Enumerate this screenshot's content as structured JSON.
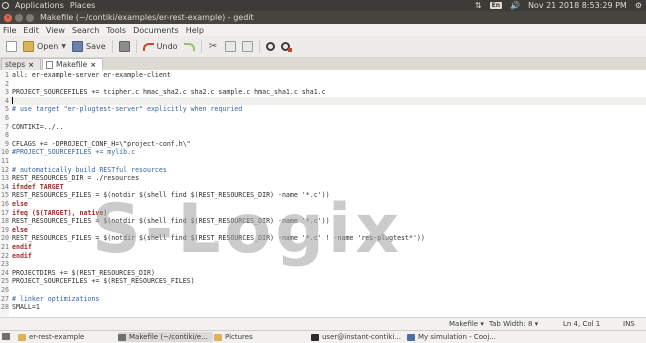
{
  "topbar": {
    "applications": "Applications",
    "places": "Places",
    "keyboard": "En",
    "datetime": "Nov 21 2018  8:53:29 PM"
  },
  "window": {
    "title": "Makefile (~/contiki/examples/er-rest-example) - gedit"
  },
  "menu": [
    "File",
    "Edit",
    "View",
    "Search",
    "Tools",
    "Documents",
    "Help"
  ],
  "toolbar": {
    "open": "Open",
    "save": "Save",
    "undo": "Undo"
  },
  "tabs": [
    {
      "label": "steps"
    },
    {
      "label": "Makefile"
    }
  ],
  "editor": {
    "lines": [
      "all: er-example-server er-example-client",
      "",
      "PROJECT_SOURCEFILES += tcipher.c hmac_sha2.c sha2.c sample.c hmac_sha1.c sha1.c",
      "",
      "# use target \"er-plugtest-server\" explicitly when requried",
      "",
      "CONTIKI=../..",
      "",
      "CFLAGS += -DPROJECT_CONF_H=\\\"project-conf.h\\\"",
      "#PROJECT_SOURCEFILES += mylib.c",
      "",
      "# automatically build RESTful resources",
      "REST_RESOURCES_DIR = ./resources",
      "ifndef TARGET",
      "REST_RESOURCES_FILES = $(notdir $(shell find $(REST_RESOURCES_DIR) -name '*.c'))",
      "else",
      "ifeq ($(TARGET), native)",
      "REST_RESOURCES_FILES = $(notdir $(shell find $(REST_RESOURCES_DIR) -name '*.c'))",
      "else",
      "REST_RESOURCES_FILES = $(notdir $(shell find $(REST_RESOURCES_DIR) -name '*.c' ! -name 'res-plugtest*'))",
      "endif",
      "endif",
      "",
      "PROJECTDIRS += $(REST_RESOURCES_DIR)",
      "PROJECT_SOURCEFILES += $(REST_RESOURCES_FILES)",
      "",
      "# linker optimizations",
      "SMALL=1"
    ]
  },
  "watermark": "S-Logix",
  "statusbar": {
    "language": "Makefile",
    "tab_width": "Tab Width: 8",
    "position": "Ln 4, Col 1",
    "mode": "INS"
  },
  "taskbar": [
    {
      "label": "er-rest-example"
    },
    {
      "label": "Makefile (~/contiki/e..."
    },
    {
      "label": "Pictures"
    },
    {
      "label": "user@instant-contiki..."
    },
    {
      "label": "My simulation - Cooj..."
    }
  ]
}
